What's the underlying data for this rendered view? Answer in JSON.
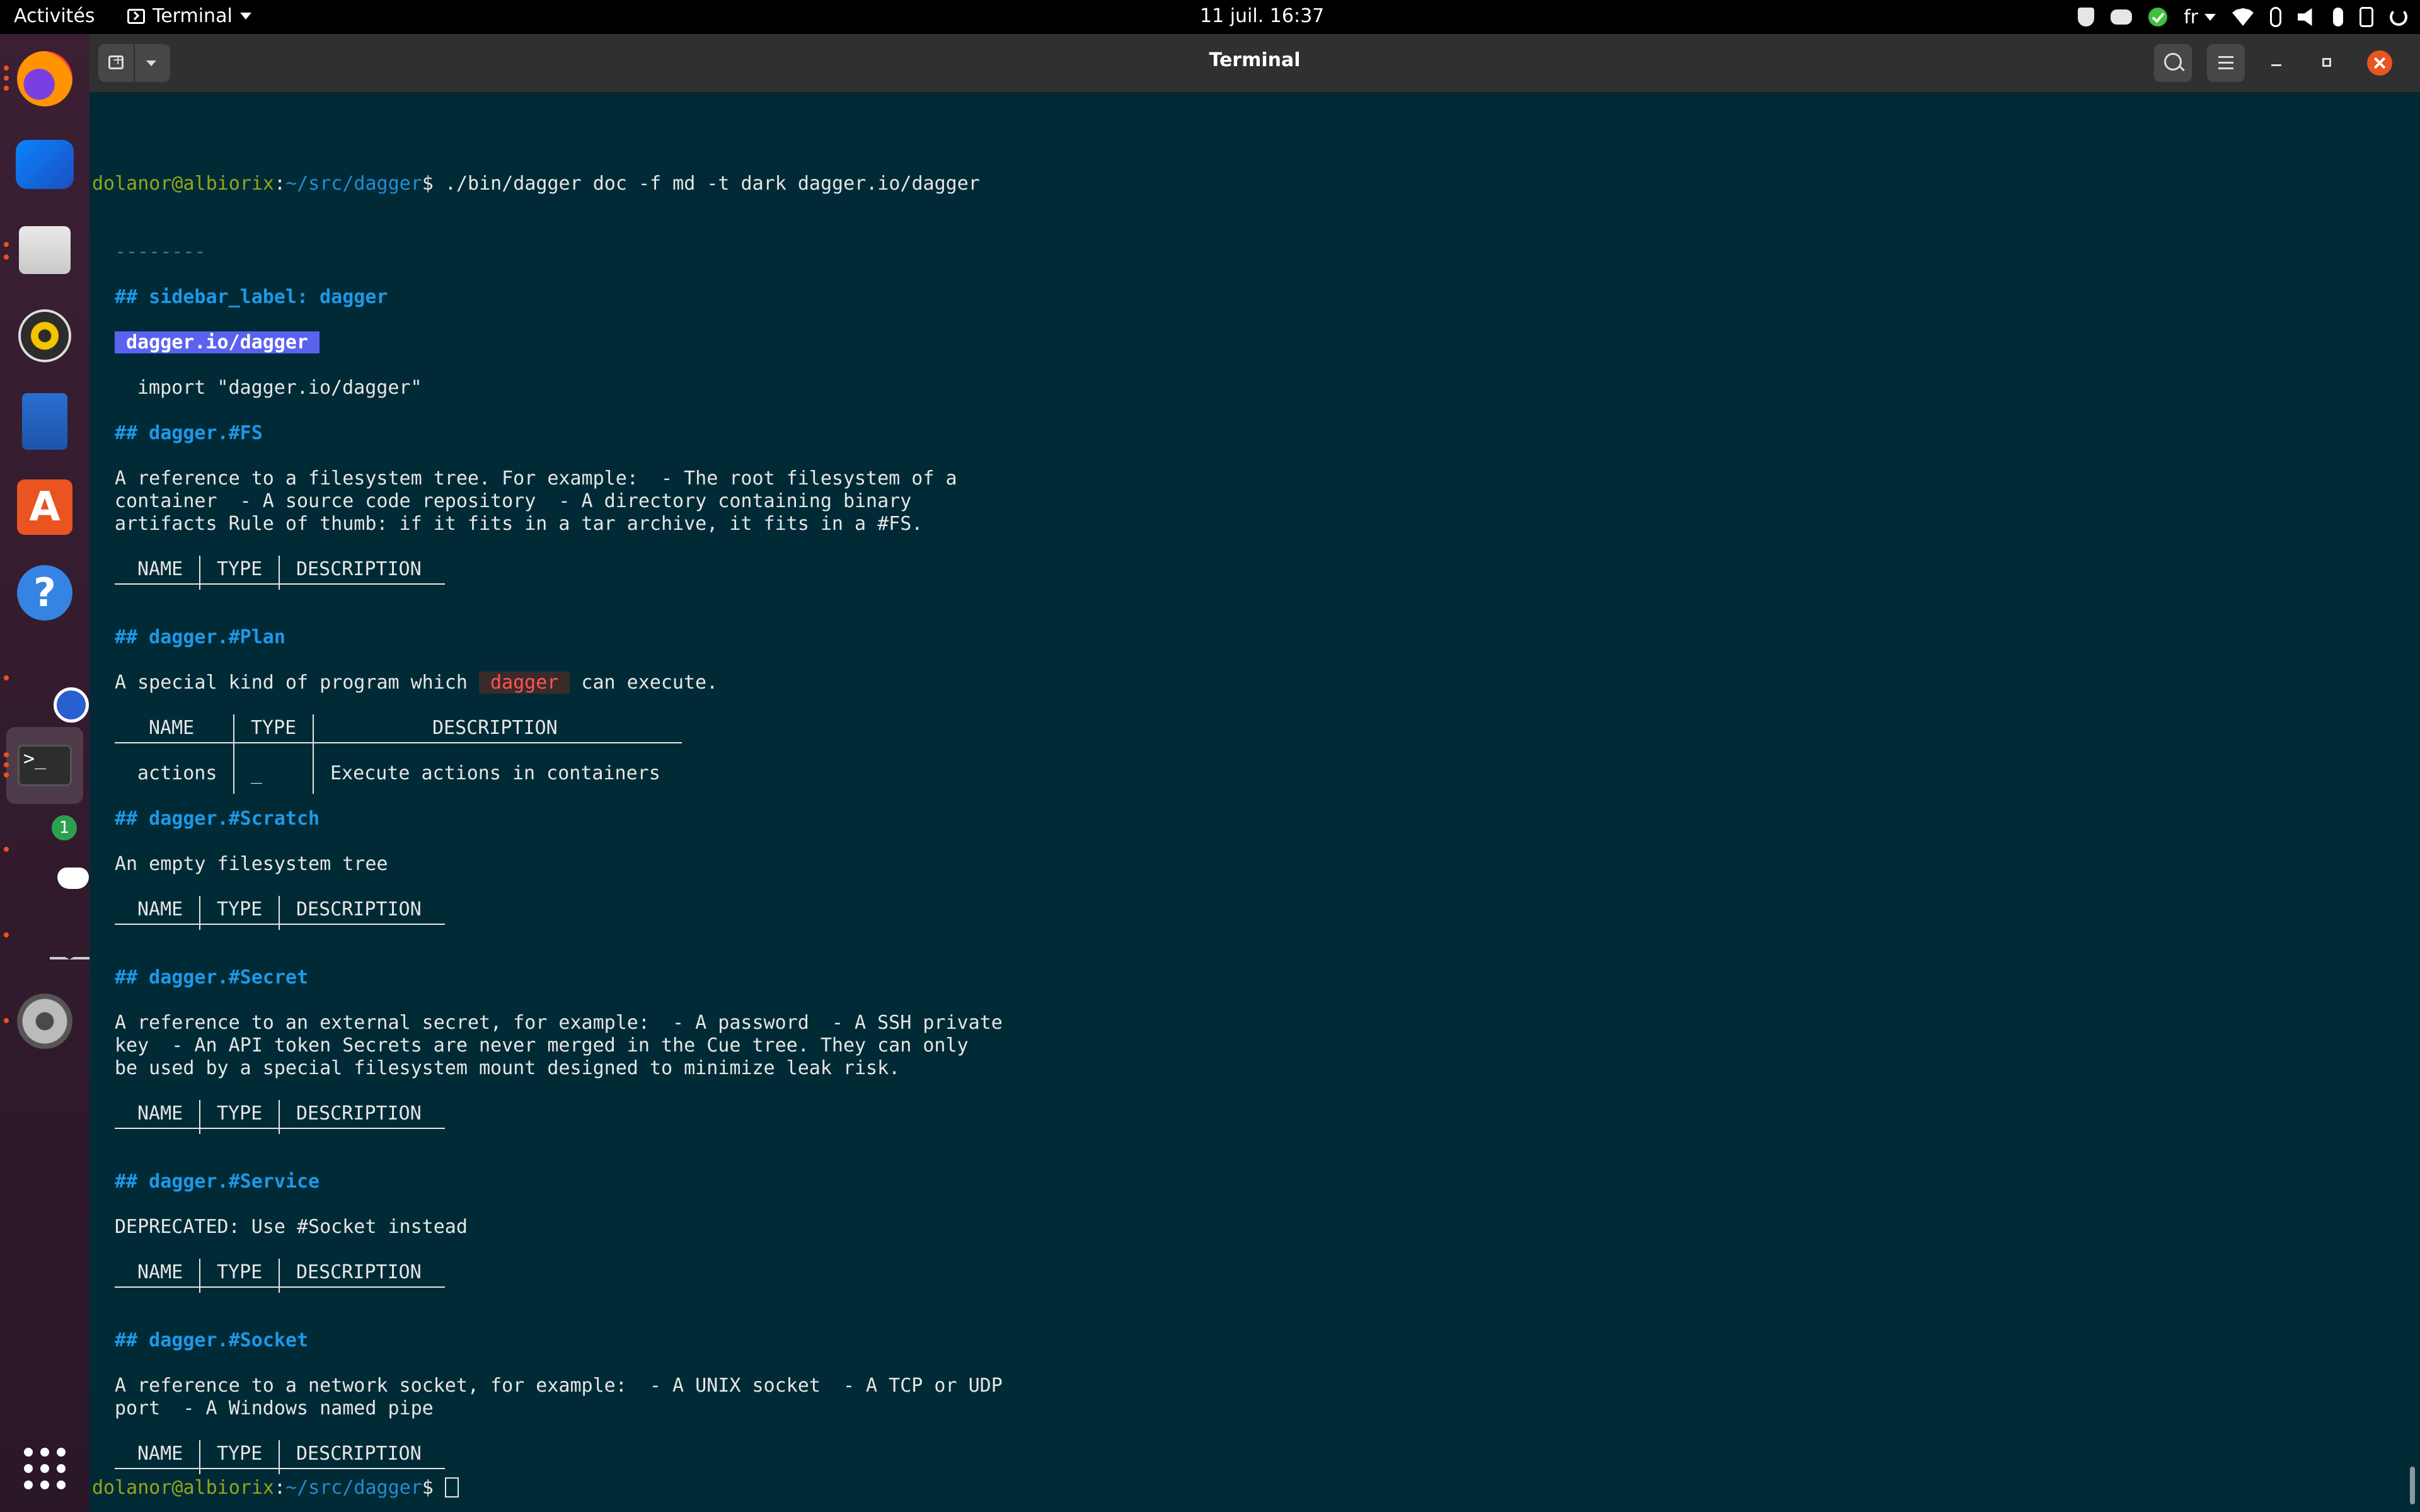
{
  "topbar": {
    "activities": "Activités",
    "app_name": "Terminal",
    "clock": "11 juil.  16:37",
    "lang": "fr"
  },
  "window": {
    "title": "Terminal"
  },
  "dock": {
    "discord_badge": "1"
  },
  "terminal": {
    "prompt_user": "dolanor@albiorix",
    "prompt_path": "~/src/dagger",
    "prompt_sym": "$ ",
    "command": "./bin/dagger doc -f md -t dark dagger.io/dagger",
    "separator": "--------",
    "sidebar_heading": "## sidebar_label: dagger",
    "package_badge": "dagger.io/dagger",
    "import_line": "import \"dagger.io/dagger\"",
    "table_header": {
      "name": "NAME",
      "type": "TYPE",
      "desc": "DESCRIPTION"
    },
    "fs": {
      "heading": "## dagger.#FS",
      "desc": [
        "A reference to a filesystem tree. For example:  - The root filesystem of a",
        "container  - A source code repository  - A directory containing binary",
        "artifacts Rule of thumb: if it fits in a tar archive, it fits in a #FS."
      ]
    },
    "plan": {
      "heading": "## dagger.#Plan",
      "desc_before": "A special kind of program which ",
      "desc_code": "dagger",
      "desc_after": " can execute.",
      "row": {
        "name": "actions",
        "type": "_",
        "desc": "Execute actions in containers"
      }
    },
    "scratch": {
      "heading": "## dagger.#Scratch",
      "desc": "An empty filesystem tree"
    },
    "secret": {
      "heading": "## dagger.#Secret",
      "desc": [
        "A reference to an external secret, for example:  - A password  - A SSH private",
        "key  - An API token Secrets are never merged in the Cue tree. They can only",
        "be used by a special filesystem mount designed to minimize leak risk."
      ]
    },
    "service": {
      "heading": "## dagger.#Service",
      "desc": "DEPRECATED: Use #Socket instead"
    },
    "socket": {
      "heading": "## dagger.#Socket",
      "desc": [
        "A reference to a network socket, for example:  - A UNIX socket  - A TCP or UDP",
        "port  - A Windows named pipe"
      ]
    }
  }
}
